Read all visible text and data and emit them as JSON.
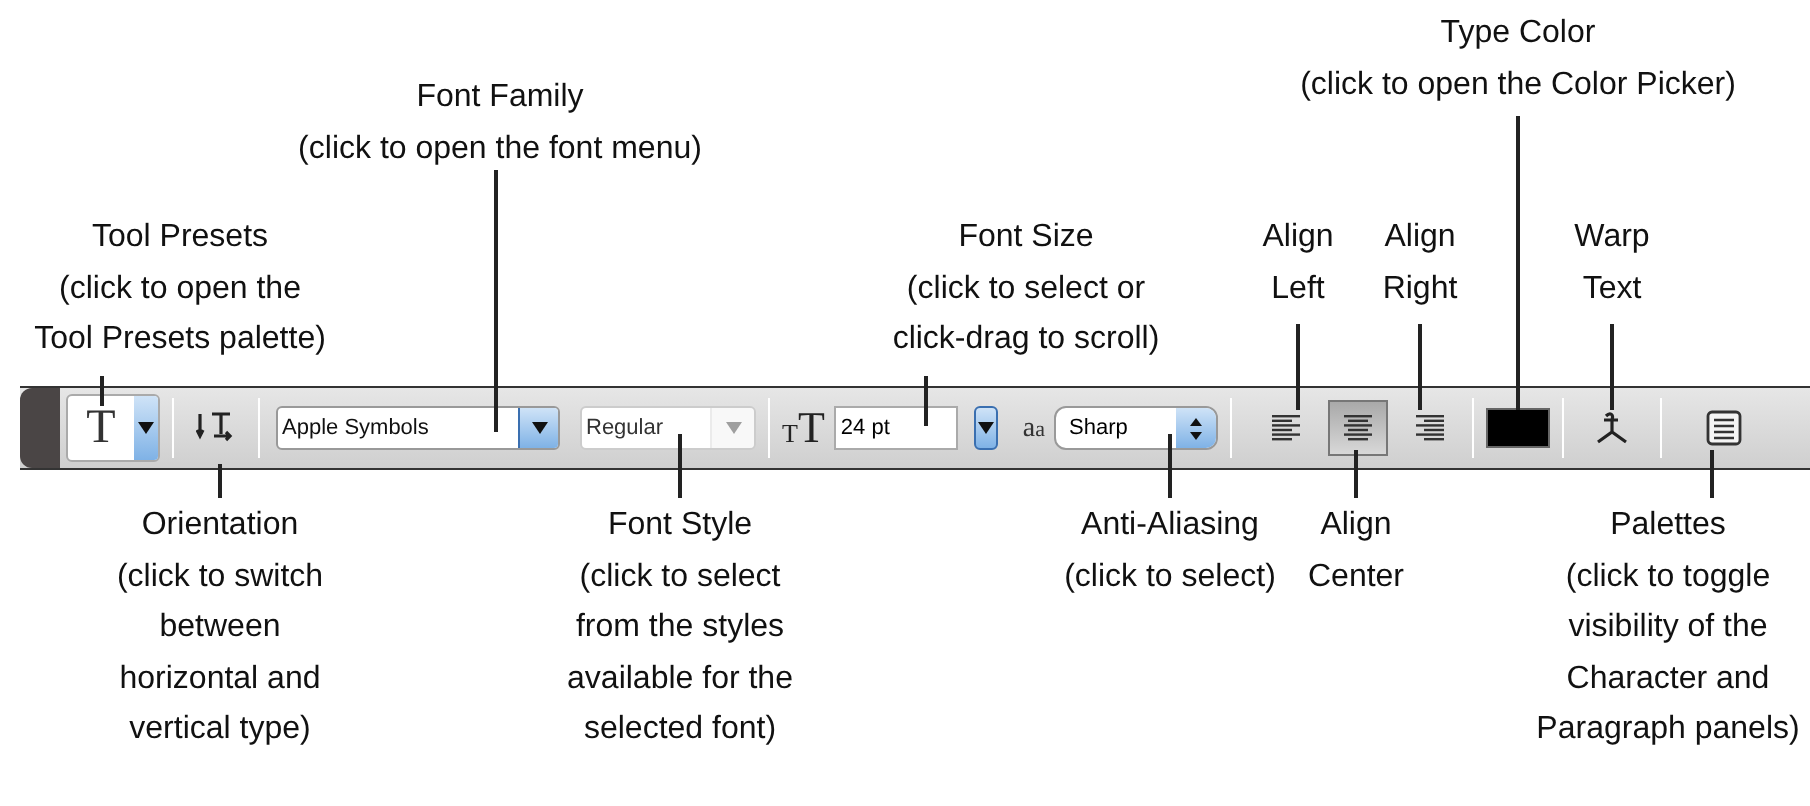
{
  "toolbar": {
    "tool_preset": {
      "label": "T"
    },
    "font_family": {
      "value": "Apple Symbols"
    },
    "font_style": {
      "value": "Regular",
      "disabled": true
    },
    "font_size": {
      "icon_letters": [
        "T",
        "T"
      ],
      "value": "24 pt"
    },
    "anti_aliasing": {
      "icon_letters": [
        "a",
        "a"
      ],
      "value": "Sharp"
    },
    "align": [
      {
        "kind": "left",
        "selected": false
      },
      {
        "kind": "center",
        "selected": true
      },
      {
        "kind": "right",
        "selected": false
      }
    ],
    "type_color": {
      "color": "#000000"
    }
  },
  "callouts": [
    {
      "text": "Tool Presets\n(click to open the\nTool Presets palette)"
    },
    {
      "text": "Font Family\n(click to open the font menu)"
    },
    {
      "text": "Font Size\n(click to select or\nclick-drag to scroll)"
    },
    {
      "text": "Align\nLeft"
    },
    {
      "text": "Align\nRight"
    },
    {
      "text": "Type Color\n(click to open the Color Picker)"
    },
    {
      "text": "Warp\nText"
    },
    {
      "text": "Orientation\n(click to switch\nbetween\nhorizontal and\nvertical type)"
    },
    {
      "text": "Font Style\n(click to select\nfrom the styles\navailable for the\nselected font)"
    },
    {
      "text": "Anti-Aliasing\n(click to select)"
    },
    {
      "text": "Align\nCenter"
    },
    {
      "text": "Palettes\n(click to toggle\nvisibility of the\nCharacter and\nParagraph panels)"
    }
  ]
}
